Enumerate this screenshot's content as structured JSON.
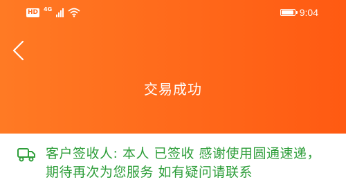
{
  "status_bar": {
    "badge": "HD",
    "network": "4G",
    "time": "9:04",
    "icons": [
      "hd-icon",
      "signal-icon",
      "wifi-icon",
      "battery-icon"
    ]
  },
  "header": {
    "back_icon": "back-arrow-icon",
    "title": "交易成功"
  },
  "logistics": {
    "icon": "truck-icon",
    "message": "客户签收人: 本人 已签收 感谢使用圆通速递，期待再次为您服务 如有疑问请联系"
  },
  "colors": {
    "header_start": "#ff7a24",
    "header_end": "#ff5a12",
    "message_text": "#2e9e3a"
  }
}
